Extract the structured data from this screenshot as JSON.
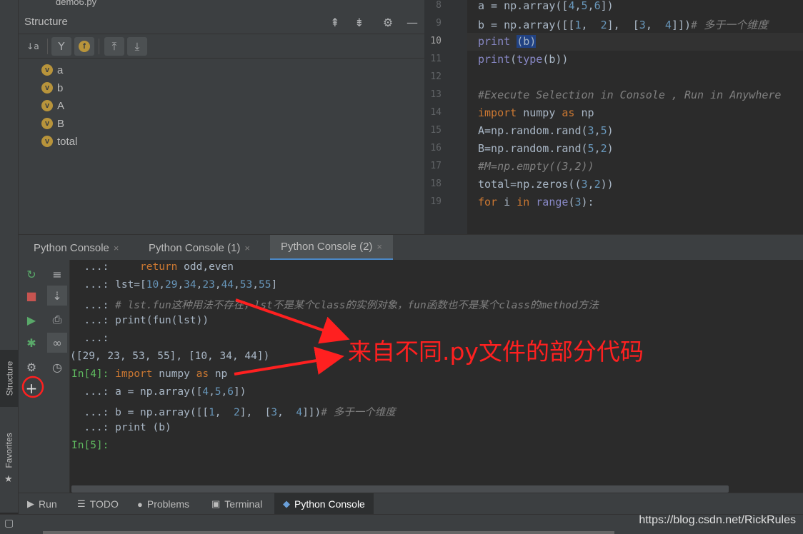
{
  "structure_panel": {
    "tab_stub": "demo6.py",
    "title": "Structure",
    "items": [
      {
        "badge": "v",
        "label": "a"
      },
      {
        "badge": "v",
        "label": "b"
      },
      {
        "badge": "v",
        "label": "A"
      },
      {
        "badge": "v",
        "label": "B"
      },
      {
        "badge": "v",
        "label": "total"
      }
    ],
    "toolbar_badge": "f",
    "sort_label": "↓a"
  },
  "left_strip": {
    "structure_label": "Structure",
    "favorites_label": "Favorites"
  },
  "editor": {
    "line_numbers": [
      "8",
      "9",
      "10",
      "11",
      "12",
      "13",
      "14",
      "15",
      "16",
      "17",
      "18",
      "19"
    ],
    "current_line": "10"
  },
  "console_tabs": [
    {
      "label": "Python Console",
      "close": "×"
    },
    {
      "label": "Python Console (1)",
      "close": "×"
    },
    {
      "label": "Python Console (2)",
      "close": "×"
    }
  ],
  "bottom_tabs": [
    {
      "label": "Run"
    },
    {
      "label": "TODO"
    },
    {
      "label": "Problems"
    },
    {
      "label": "Terminal"
    },
    {
      "label": "Python Console"
    }
  ],
  "annotation": "来自不同.py文件的部分代码",
  "watermark": "https://blog.csdn.net/RickRules",
  "colors": {
    "background": "#2b2b2b",
    "panel": "#3c3f41",
    "keyword": "#cc7832",
    "number": "#6897bb",
    "prompt": "#5fb95f",
    "annotation": "#ff2020"
  }
}
